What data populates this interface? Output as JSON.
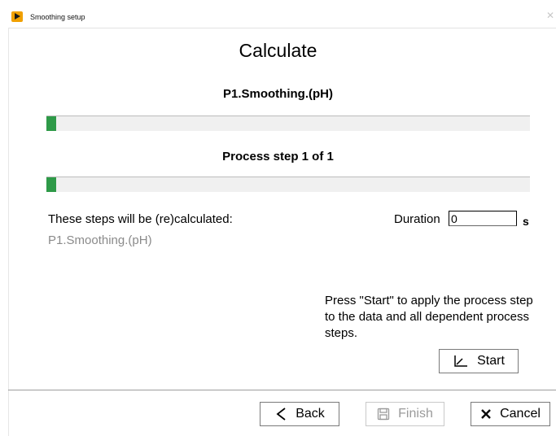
{
  "window": {
    "title": "Smoothing setup",
    "close_glyph": "✕"
  },
  "page": {
    "heading": "Calculate",
    "process_name": "P1.Smoothing.(pH)",
    "step_text": "Process step 1 of 1"
  },
  "progress": {
    "overall_fraction": 0.003,
    "step_fraction": 0.003,
    "fill_color": "#2e9a48"
  },
  "steps": {
    "label": "These steps will be (re)calculated:",
    "items": [
      "P1.Smoothing.(pH)"
    ]
  },
  "duration": {
    "label": "Duration",
    "value": "0",
    "unit": "s"
  },
  "info": {
    "text": "Press \"Start\" to apply the process step to the data and all dependent process steps."
  },
  "buttons": {
    "start": {
      "label": "Start",
      "icon": "chart-line-icon"
    },
    "back": {
      "label": "Back",
      "icon": "chevron-left-icon"
    },
    "finish": {
      "label": "Finish",
      "icon": "save-icon",
      "disabled": true
    },
    "cancel": {
      "label": "Cancel",
      "icon": "close-icon"
    }
  },
  "colors": {
    "app_icon": "#f0a000",
    "disabled_text": "#9a9a9a",
    "muted_text": "#8a8a8a"
  }
}
